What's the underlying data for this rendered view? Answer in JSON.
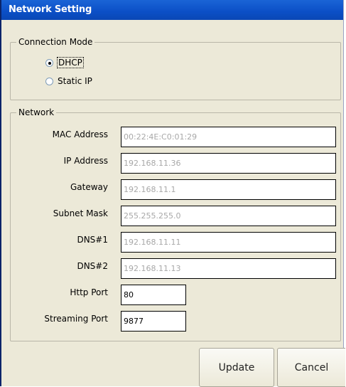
{
  "window": {
    "title": "Network Setting"
  },
  "connection_mode": {
    "legend": "Connection Mode",
    "options": [
      {
        "label": "DHCP",
        "checked": true
      },
      {
        "label": "Static IP",
        "checked": false
      }
    ]
  },
  "network": {
    "legend": "Network",
    "fields": [
      {
        "label": "MAC Address",
        "value": "00:22:4E:C0:01:29",
        "enabled": false
      },
      {
        "label": "IP Address",
        "value": "192.168.11.36",
        "enabled": false
      },
      {
        "label": "Gateway",
        "value": "192.168.11.1",
        "enabled": false
      },
      {
        "label": "Subnet Mask",
        "value": "255.255.255.0",
        "enabled": false
      },
      {
        "label": "DNS#1",
        "value": "192.168.11.11",
        "enabled": false
      },
      {
        "label": "DNS#2",
        "value": "192.168.11.13",
        "enabled": false
      },
      {
        "label": "Http Port",
        "value": "80",
        "enabled": true
      },
      {
        "label": "Streaming Port",
        "value": "9877",
        "enabled": true
      }
    ]
  },
  "buttons": {
    "update": "Update",
    "cancel": "Cancel"
  },
  "colors": {
    "titlebar": "#0b4fc6",
    "dialog_bg": "#ece9d8",
    "disabled_text": "#a8a8a8"
  }
}
